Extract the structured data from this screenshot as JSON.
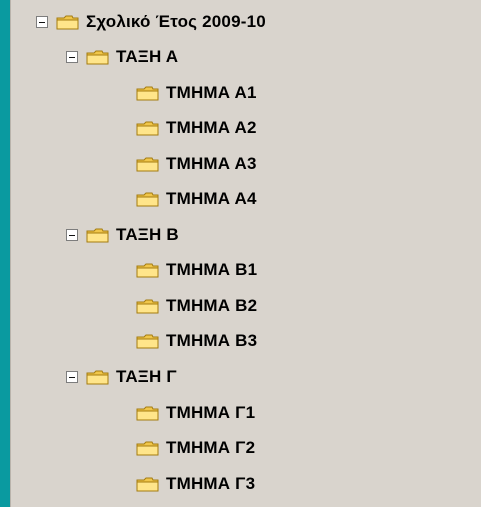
{
  "window": {
    "background_color": "#0a9aa0",
    "panel_color": "#d9d4cd"
  },
  "tree": {
    "root_label": "Σχολικό Έτος 2009-10",
    "groups": [
      {
        "label": "ΤΑΞΗ Α",
        "children": [
          "ΤΜΗΜΑ Α1",
          "ΤΜΗΜΑ Α2",
          "ΤΜΗΜΑ Α3",
          "ΤΜΗΜΑ Α4"
        ]
      },
      {
        "label": "ΤΑΞΗ Β",
        "children": [
          "ΤΜΗΜΑ Β1",
          "ΤΜΗΜΑ Β2",
          "ΤΜΗΜΑ Β3"
        ]
      },
      {
        "label": "ΤΑΞΗ Γ",
        "children": [
          "ΤΜΗΜΑ Γ1",
          "ΤΜΗΜΑ Γ2",
          "ΤΜΗΜΑ Γ3"
        ]
      }
    ]
  },
  "icons": {
    "toggle": "minus-toggle-icon",
    "folder": "folder-icon"
  }
}
